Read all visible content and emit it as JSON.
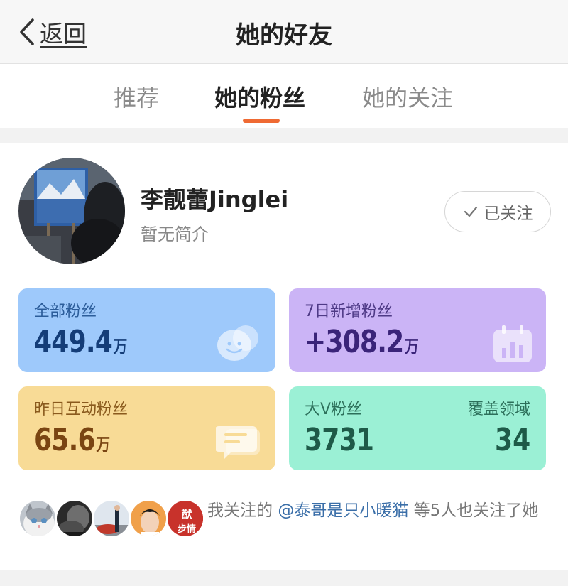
{
  "nav": {
    "back_label": "返回",
    "title": "她的好友"
  },
  "tabs": [
    {
      "label": "推荐",
      "active": false
    },
    {
      "label": "她的粉丝",
      "active": true
    },
    {
      "label": "她的关注",
      "active": false
    }
  ],
  "profile": {
    "name": "李靓蕾Jinglei",
    "bio": "暂无简介",
    "follow_label": "已关注"
  },
  "stats": {
    "all_fans": {
      "label": "全部粉丝",
      "value": "449.4",
      "unit": "万",
      "color": "#9ec9fb"
    },
    "new_fans_7d": {
      "label": "7日新增粉丝",
      "value": "+308.2",
      "unit": "万",
      "color": "#cbb4f6"
    },
    "interactive_fans_yesterday": {
      "label": "昨日互动粉丝",
      "value": "65.6",
      "unit": "万",
      "color": "#f8db96"
    },
    "big_v_fans": {
      "label": "大V粉丝",
      "value": "3731",
      "coverage_label": "覆盖领域",
      "coverage_value": "34",
      "color": "#9bf0d5"
    }
  },
  "mutual": {
    "prefix": "我关注的 ",
    "highlight": "@泰哥是只小暖猫",
    "suffix": " 等5人也关注了她",
    "avatar_badge_text": "猷 步情"
  },
  "colors": {
    "accent": "#ef6a33",
    "link": "#3a6ea8"
  }
}
